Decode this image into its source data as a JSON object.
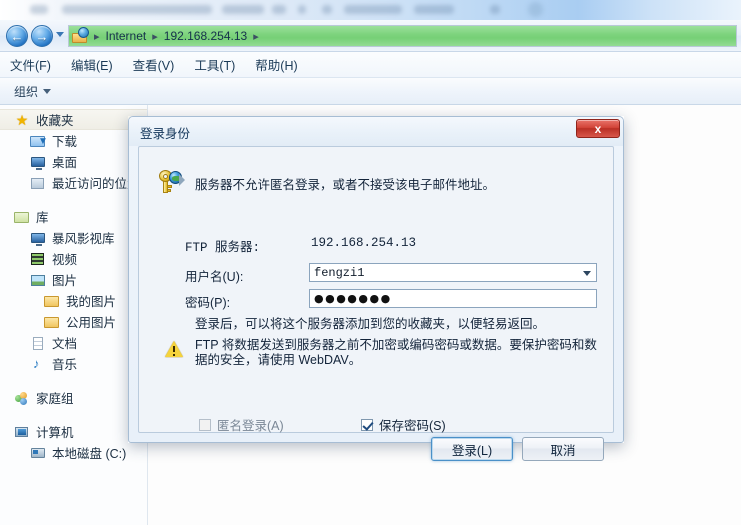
{
  "window": {
    "address_bar": {
      "icon": "ftp-globe-folder-icon",
      "back_label": "←",
      "forward_label": "→",
      "crumbs": [
        "Internet",
        "192.168.254.13"
      ],
      "separator": "▸"
    },
    "menubar": {
      "items": [
        {
          "label": "文件(F)",
          "name": "menu-file"
        },
        {
          "label": "编辑(E)",
          "name": "menu-edit"
        },
        {
          "label": "查看(V)",
          "name": "menu-view"
        },
        {
          "label": "工具(T)",
          "name": "menu-tools"
        },
        {
          "label": "帮助(H)",
          "name": "menu-help"
        }
      ]
    },
    "toolbar": {
      "organize_label": "组织"
    }
  },
  "sidebar": {
    "groups": [
      {
        "header": {
          "label": "收藏夹",
          "icon": "star-icon",
          "selected": true
        },
        "items": [
          {
            "label": "下载",
            "icon": "download-folder-icon"
          },
          {
            "label": "桌面",
            "icon": "desktop-icon"
          },
          {
            "label": "最近访问的位置",
            "icon": "recent-places-icon"
          }
        ]
      },
      {
        "header": {
          "label": "库",
          "icon": "library-icon",
          "selected": false
        },
        "items": [
          {
            "label": "暴风影视库",
            "icon": "media-library-icon"
          },
          {
            "label": "视频",
            "icon": "video-icon"
          },
          {
            "label": "图片",
            "icon": "pictures-icon"
          },
          {
            "label": "我的图片",
            "icon": "my-pictures-folder-icon",
            "sub": true
          },
          {
            "label": "公用图片",
            "icon": "public-pictures-folder-icon",
            "sub": true
          },
          {
            "label": "文档",
            "icon": "documents-icon"
          },
          {
            "label": "音乐",
            "icon": "music-icon"
          }
        ]
      },
      {
        "header": {
          "label": "家庭组",
          "icon": "homegroup-icon",
          "selected": false
        },
        "items": []
      },
      {
        "header": {
          "label": "计算机",
          "icon": "computer-icon",
          "selected": false
        },
        "items": [
          {
            "label": "本地磁盘 (C:)",
            "icon": "local-disk-icon"
          }
        ]
      }
    ]
  },
  "dialog": {
    "title": "登录身份",
    "close_label": "×",
    "close_glyph": "x",
    "message": "服务器不允许匿名登录，或者不接受该电子邮件地址。",
    "fields": {
      "server_label": "FTP 服务器:",
      "server_value": "192.168.254.13",
      "username_label": "用户名(U):",
      "username_value": "fengzi1",
      "username_placeholder": "",
      "password_label": "密码(P):",
      "password_value": "●●●●●●●",
      "password_placeholder": ""
    },
    "favorites_note": "登录后，可以将这个服务器添加到您的收藏夹，以便轻易返回。",
    "warning_text": "FTP 将数据发送到服务器之前不加密或编码密码或数据。要保护密码和数据的安全，请使用 WebDAV。",
    "checkboxes": {
      "anonymous_label": "匿名登录(A)",
      "anonymous_checked": false,
      "anonymous_disabled": true,
      "save_password_label": "保存密码(S)",
      "save_password_checked": true
    },
    "buttons": {
      "login_label": "登录(L)",
      "cancel_label": "取消"
    }
  },
  "colors": {
    "address_bar_fill": "#7ed47e",
    "dialog_close_red": "#d24438",
    "accent_blue": "#1e6fc0",
    "warning_yellow": "#f5d33c"
  }
}
